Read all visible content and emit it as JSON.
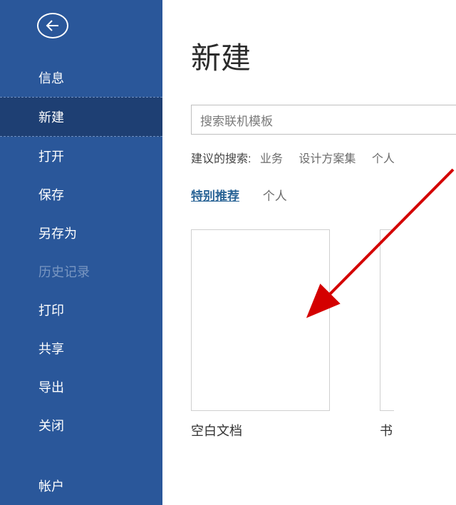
{
  "sidebar": {
    "items": [
      {
        "key": "info",
        "label": "信息"
      },
      {
        "key": "new",
        "label": "新建"
      },
      {
        "key": "open",
        "label": "打开"
      },
      {
        "key": "save",
        "label": "保存"
      },
      {
        "key": "saveas",
        "label": "另存为"
      },
      {
        "key": "history",
        "label": "历史记录"
      },
      {
        "key": "print",
        "label": "打印"
      },
      {
        "key": "share",
        "label": "共享"
      },
      {
        "key": "export",
        "label": "导出"
      },
      {
        "key": "close",
        "label": "关闭"
      },
      {
        "key": "account",
        "label": "帐户"
      }
    ]
  },
  "main": {
    "title": "新建",
    "search_placeholder": "搜索联机模板",
    "suggested_label": "建议的搜索:",
    "suggested_links": [
      "业务",
      "设计方案集",
      "个人"
    ],
    "tabs": [
      "特别推荐",
      "个人"
    ],
    "active_tab": 0,
    "templates": [
      {
        "label": "空白文档"
      },
      {
        "label": "书"
      }
    ]
  },
  "colors": {
    "sidebar_bg": "#2a579a",
    "sidebar_active_bg": "#1e3f73",
    "link_blue": "#2a6496"
  }
}
